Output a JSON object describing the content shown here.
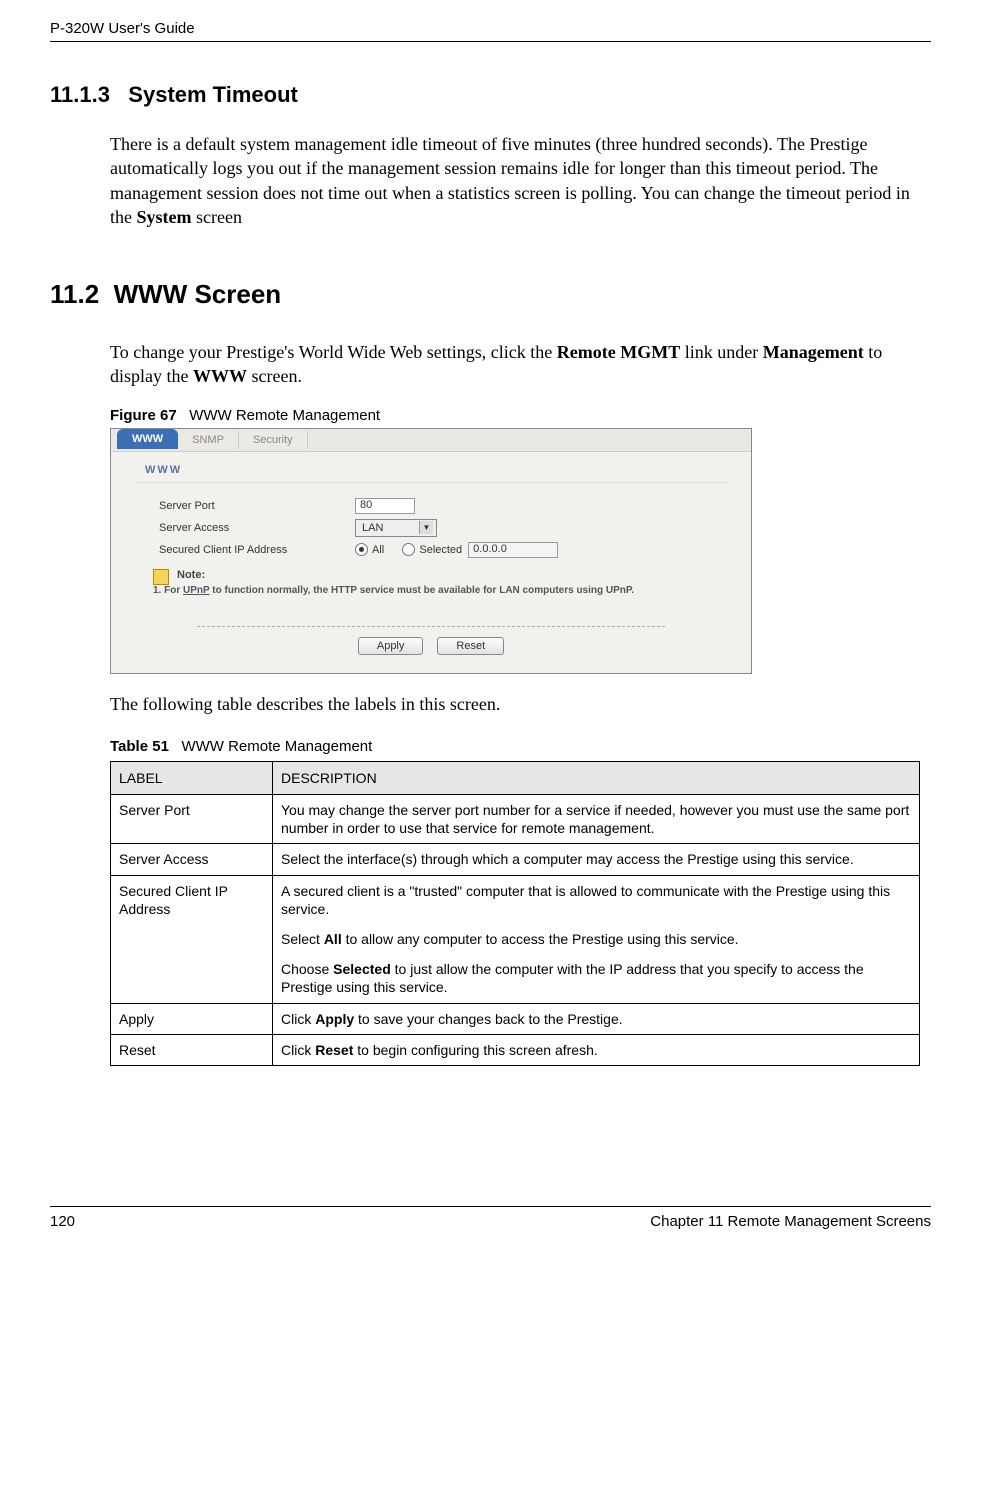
{
  "header": {
    "manual_title": "P-320W User's Guide"
  },
  "section_1113": {
    "number": "11.1.3",
    "title": "System Timeout",
    "body_pre": "There is a default system management idle timeout of five minutes (three hundred seconds). The Prestige automatically logs you out if the management session remains idle for longer than this timeout period. The management session does not time out when a statistics screen is polling. You can change the timeout period in the ",
    "body_bold": "System",
    "body_post": " screen"
  },
  "section_112": {
    "number": "11.2",
    "title": "WWW Screen",
    "intro_p1": "To change your Prestige's World Wide Web settings, click the ",
    "intro_b1": "Remote MGMT",
    "intro_p2": " link under ",
    "intro_b2": "Management",
    "intro_p3": " to display the ",
    "intro_b3": "WWW",
    "intro_p4": " screen."
  },
  "figure67": {
    "label": "Figure 67",
    "caption": "WWW Remote Management",
    "tabs": {
      "www": "WWW",
      "snmp": "SNMP",
      "security": "Security"
    },
    "section_label": "WWW",
    "form": {
      "server_port_label": "Server Port",
      "server_port_value": "80",
      "server_access_label": "Server Access",
      "server_access_value": "LAN",
      "secured_ip_label": "Secured Client IP Address",
      "radio_all": "All",
      "radio_selected": "Selected",
      "selected_ip_value": "0.0.0.0"
    },
    "note": {
      "heading": "Note:",
      "line_prefix": "1. For ",
      "line_link": "UPnP",
      "line_suffix": " to function normally, the HTTP service must be available for LAN computers using UPnP."
    },
    "buttons": {
      "apply": "Apply",
      "reset": "Reset"
    }
  },
  "table_intro": "The following table describes the labels in this screen.",
  "table51": {
    "label": "Table 51",
    "caption": "WWW Remote Management",
    "headers": {
      "label": "LABEL",
      "description": "DESCRIPTION"
    },
    "rows": [
      {
        "label": "Server Port",
        "desc": "You may change the server port number for a service if needed, however you must use the same port number in order to use that service for remote management."
      },
      {
        "label": "Server Access",
        "desc": "Select the interface(s) through which a computer may access the Prestige using this service."
      },
      {
        "label": "Secured Client IP Address",
        "desc_p1": "A secured client is a \"trusted\" computer that is allowed to communicate with the Prestige using this service.",
        "desc_p2a": "Select ",
        "desc_p2b": "All",
        "desc_p2c": " to allow any computer to access the Prestige using this service.",
        "desc_p3a": "Choose ",
        "desc_p3b": "Selected",
        "desc_p3c": " to just allow the computer with the IP address that you specify to access the Prestige using this service."
      },
      {
        "label": "Apply",
        "desc_a": "Click ",
        "desc_b": "Apply",
        "desc_c": " to save your changes back to the Prestige."
      },
      {
        "label": "Reset",
        "desc_a": "Click ",
        "desc_b": "Reset",
        "desc_c": " to begin configuring this screen afresh."
      }
    ]
  },
  "footer": {
    "page_number": "120",
    "chapter": "Chapter 11 Remote Management Screens"
  }
}
